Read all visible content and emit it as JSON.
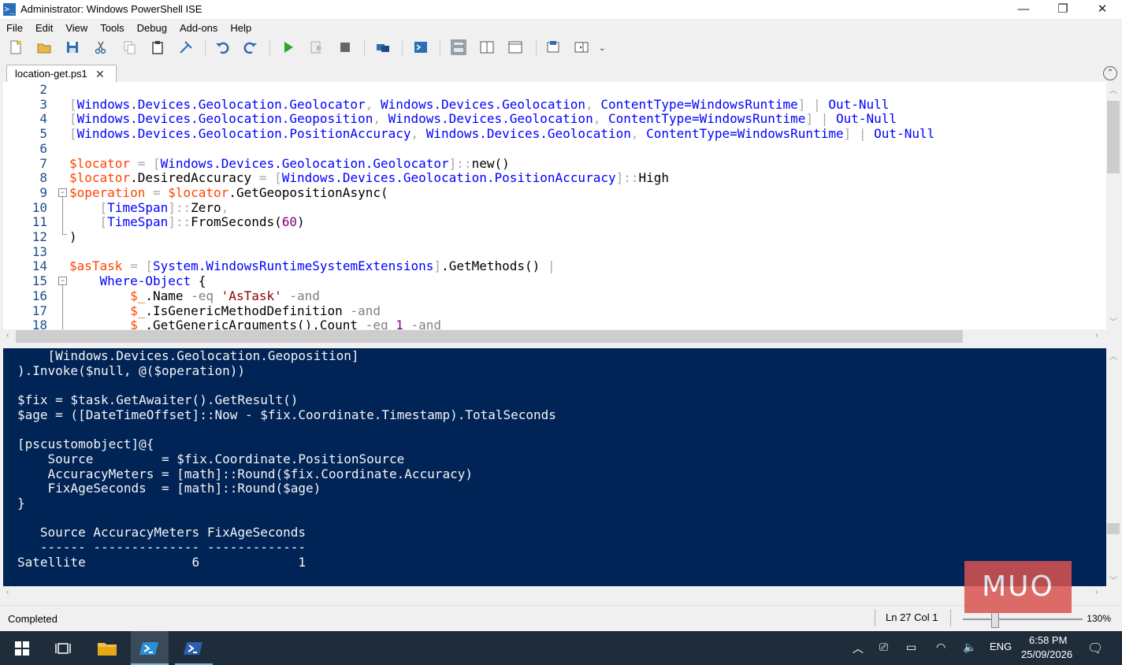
{
  "window": {
    "title": "Administrator: Windows PowerShell ISE",
    "minimize": "—",
    "maximize": "❐",
    "close": "✕"
  },
  "menu": [
    "File",
    "Edit",
    "View",
    "Tools",
    "Debug",
    "Add-ons",
    "Help"
  ],
  "tab": {
    "label": "location-get.ps1",
    "close": "✕"
  },
  "editor": {
    "line_numbers": [
      "2",
      "3",
      "4",
      "5",
      "6",
      "7",
      "8",
      "9",
      "10",
      "11",
      "12",
      "13",
      "14",
      "15",
      "16",
      "17",
      "18"
    ]
  },
  "console": {
    "lines": [
      "    [Windows.Devices.Geolocation.Geoposition]",
      ").Invoke($null, @($operation))",
      "",
      "$fix = $task.GetAwaiter().GetResult()",
      "$age = ([DateTimeOffset]::Now - $fix.Coordinate.Timestamp).TotalSeconds",
      "",
      "[pscustomobject]@{",
      "    Source         = $fix.Coordinate.PositionSource",
      "    AccuracyMeters = [math]::Round($fix.Coordinate.Accuracy)",
      "    FixAgeSeconds  = [math]::Round($age)",
      "}",
      "",
      "",
      "   Source AccuracyMeters FixAgeSeconds",
      "   ------ -------------- -------------",
      "Satellite              6             1"
    ]
  },
  "status": {
    "text": "Completed",
    "position": "Ln 27  Col 1",
    "zoom": "130%",
    "zoom_level_percent": 130
  },
  "watermark": "MUO",
  "taskbar": {
    "tray_lang": "ENG",
    "time": "6:58 PM",
    "date": "25/09/2026"
  },
  "colors": {
    "console_bg": "#012456",
    "types": "#0000ff",
    "variables": "#ff4500",
    "strings": "#8b0000",
    "numbers": "#800080",
    "taskbar": "#1f2d3a"
  },
  "icons": [
    "windows-icon",
    "task-view-icon",
    "file-explorer-icon",
    "powershell-ise-icon",
    "powershell-icon"
  ]
}
